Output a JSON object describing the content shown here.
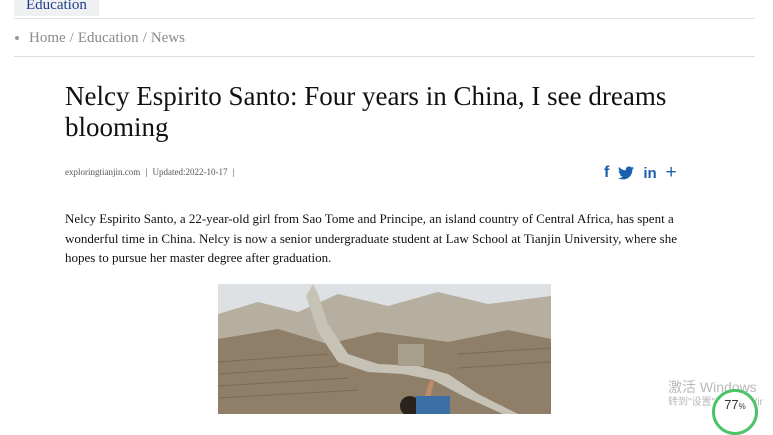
{
  "section_tab": "Education",
  "breadcrumb": {
    "items": [
      "Home",
      "Education",
      "News"
    ],
    "separator": "/"
  },
  "article": {
    "title": "Nelcy Espirito Santo: Four years in China, I see dreams blooming",
    "source": "exploringtianjin.com",
    "updated": "Updated:2022-10-17",
    "share_icons": [
      "facebook-icon",
      "twitter-icon",
      "linkedin-icon",
      "plus-icon"
    ],
    "lead": "Nelcy Espirito Santo, a 22-year-old girl from Sao Tome and Principe, an island country of Central Africa, has spent a wonderful time in China. Nelcy is now a senior undergraduate student at Law School at Tianjin University, where she hopes to pursue her master degree after graduation."
  },
  "overlay": {
    "watermark_line1": "激活 Windows",
    "watermark_line2": "转到\"设置\"以激活 Wir",
    "gauge_value": "77",
    "gauge_unit": "%"
  },
  "colors": {
    "link_blue": "#1b5fb0",
    "tab_text": "#1d3e8a",
    "gauge_green": "#4cc26a"
  }
}
